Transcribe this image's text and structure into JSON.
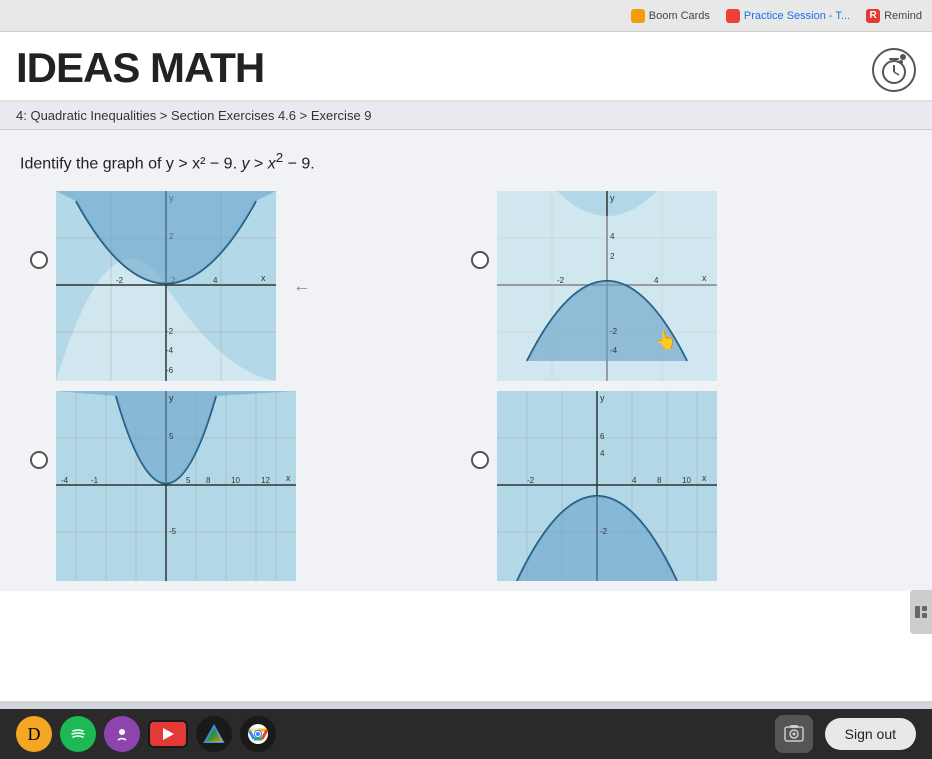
{
  "browser": {
    "tabs": [
      {
        "label": "Boom Cards",
        "active": false
      },
      {
        "label": "Practice Session - T...",
        "active": false
      },
      {
        "label": "Remind",
        "active": false
      }
    ]
  },
  "header": {
    "logo": "IDEAS MATH",
    "timer_label": "timer"
  },
  "breadcrumb": {
    "text": "4: Quadratic Inequalities > Section Exercises 4.6 > Exercise 9"
  },
  "question": {
    "text": "Identify the graph of y > x² − 9."
  },
  "graphs": [
    {
      "id": "A",
      "selected": false,
      "position": "top-left"
    },
    {
      "id": "B",
      "selected": false,
      "position": "top-right"
    },
    {
      "id": "C",
      "selected": false,
      "position": "bottom-left"
    },
    {
      "id": "D",
      "selected": false,
      "position": "bottom-right"
    }
  ],
  "taskbar": {
    "icons": [
      {
        "name": "drive-icon",
        "color": "#f5a623"
      },
      {
        "name": "spotify-icon",
        "color": "#1db954"
      },
      {
        "name": "podcast-icon",
        "color": "#8e44ad"
      },
      {
        "name": "youtube-icon",
        "color": "#e53935"
      },
      {
        "name": "drive-triangle-icon",
        "color": "#4285f4"
      },
      {
        "name": "chrome-icon",
        "color": "#34a853"
      }
    ],
    "sign_out_label": "Sign out"
  }
}
